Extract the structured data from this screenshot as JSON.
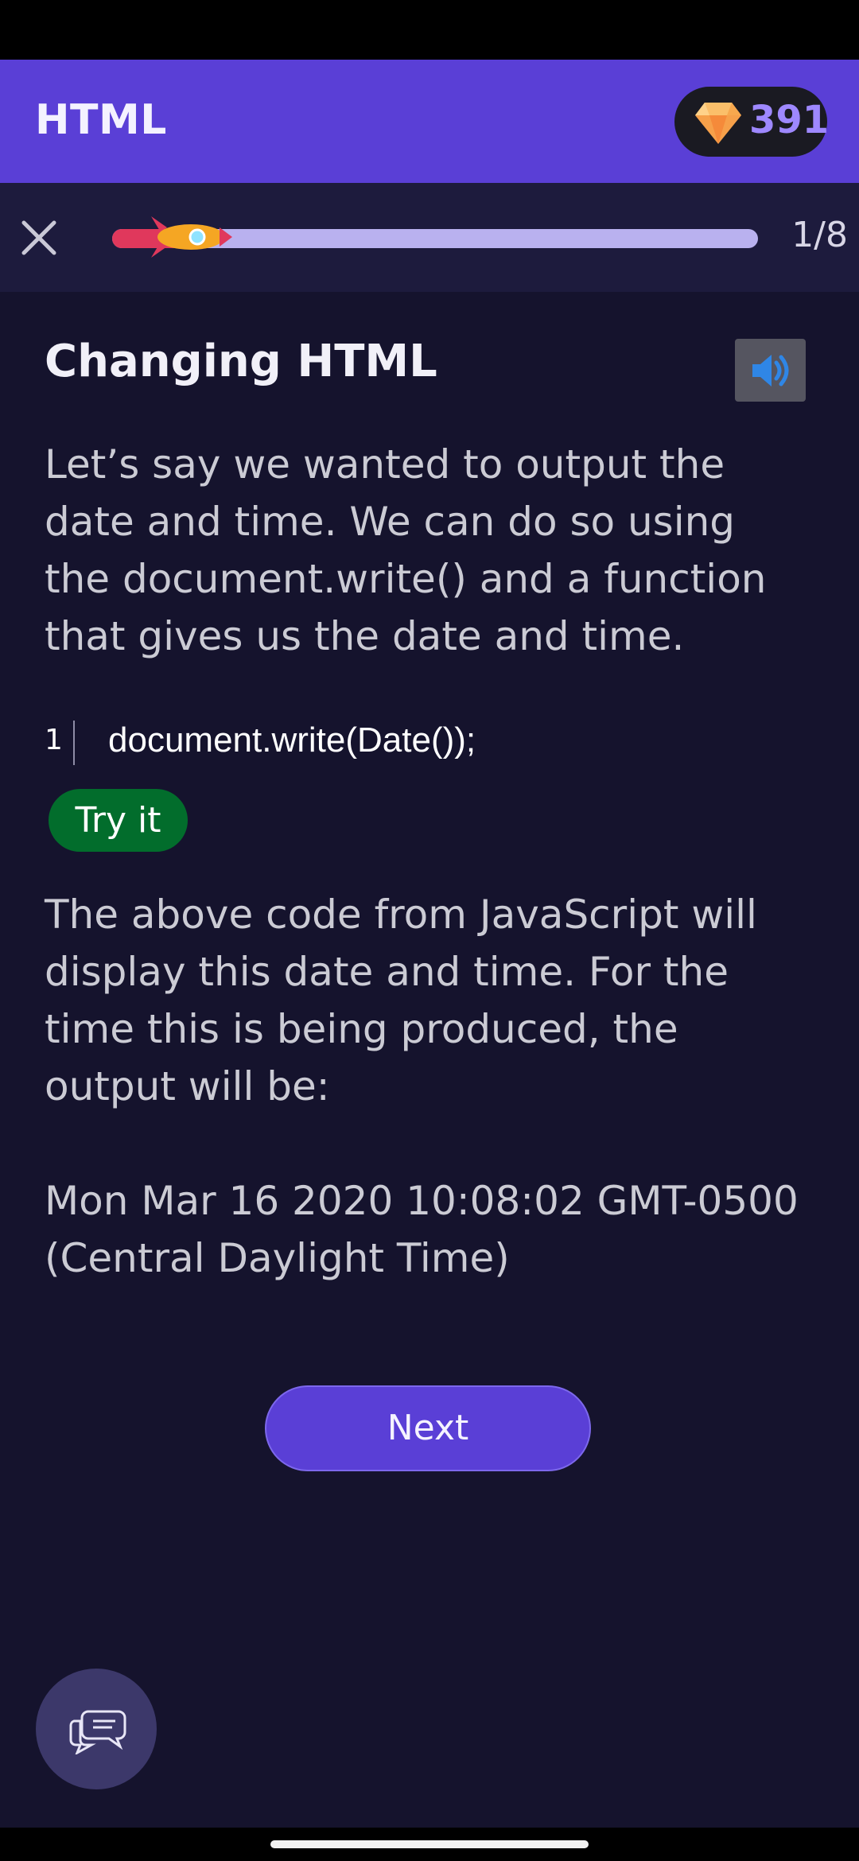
{
  "app": {
    "title": "HTML",
    "gems": "391"
  },
  "progress": {
    "step": "1/8",
    "fraction": 0.125
  },
  "lesson": {
    "title": "Changing HTML",
    "intro": "Let’s say we wanted to output the date and time. We can do so using the document.write() and a function that gives us the date and time.",
    "code": {
      "line_number": "1",
      "text": "document.write(Date());"
    },
    "try_label": "Try it",
    "explanation": "The above code from JavaScript will display this date and time. For the time this is being produced, the output will be:",
    "output": "Mon Mar 16 2020 10:08:02 GMT-0500 (Central Daylight Time)"
  },
  "next_label": "Next",
  "colors": {
    "background": "#15132d",
    "accent": "#5a3fd6",
    "progress_fill": "#e0385c",
    "progress_track": "#b9b1ef",
    "try_button": "#026d2c"
  }
}
